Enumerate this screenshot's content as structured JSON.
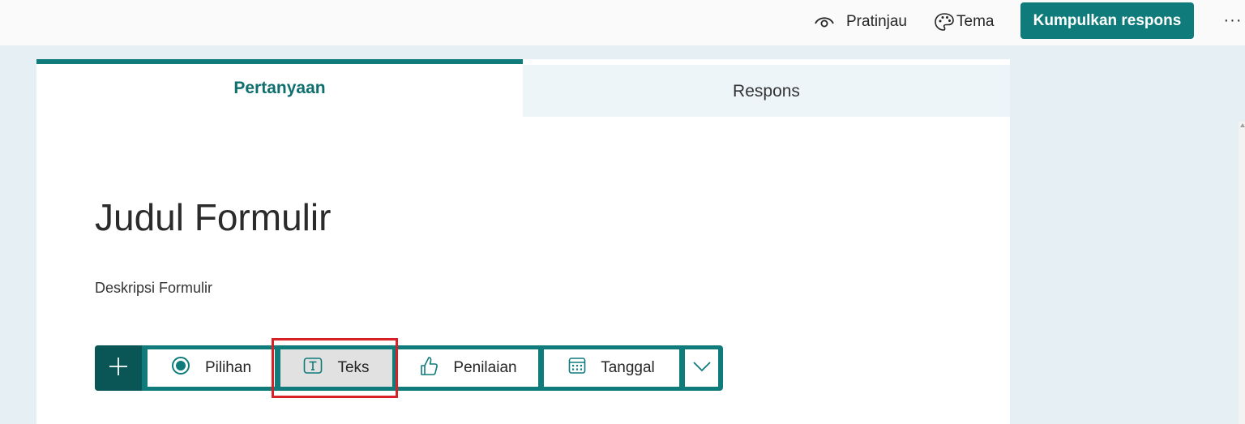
{
  "header": {
    "preview_label": "Pratinjau",
    "preview_icon": "eye-icon",
    "theme_label": "Tema",
    "theme_icon": "palette-icon",
    "collect_label": "Kumpulkan respons",
    "more_label": "···"
  },
  "tabs": [
    {
      "label": "Pertanyaan",
      "active": true
    },
    {
      "label": "Respons",
      "active": false
    }
  ],
  "form": {
    "title": "Judul Formulir",
    "description": "Deskripsi Formulir"
  },
  "insert_toolbar": {
    "add_icon": "plus-icon",
    "items": [
      {
        "label": "Pilihan",
        "icon": "radio-button-icon"
      },
      {
        "label": "Teks",
        "icon": "text-box-icon",
        "highlighted": true
      },
      {
        "label": "Penilaian",
        "icon": "thumbs-up-icon"
      },
      {
        "label": "Tanggal",
        "icon": "calendar-icon"
      }
    ],
    "more_icon": "chevron-down-icon"
  },
  "colors": {
    "accent": "#0f7b7b",
    "accent_dark": "#0a5656",
    "highlight": "#d92027",
    "page_background": "#e6f0f4"
  }
}
